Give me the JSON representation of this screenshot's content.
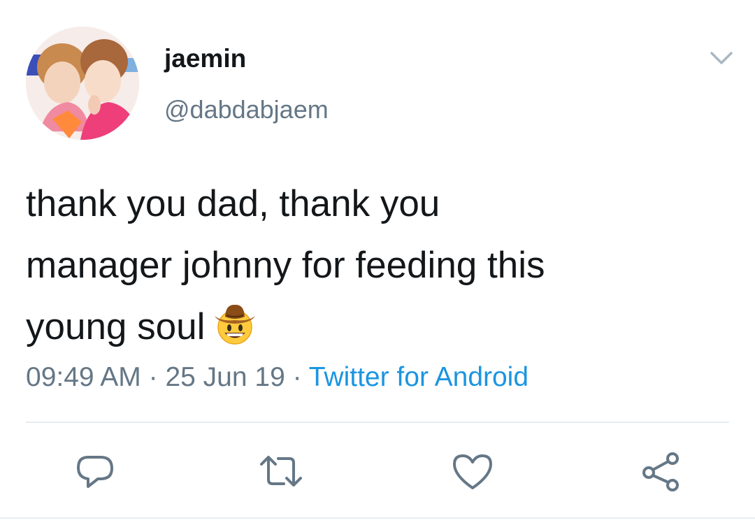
{
  "tweet": {
    "author": {
      "display_name": "jaemin",
      "handle": "@dabdabjaem"
    },
    "text": "thank you dad, thank you\nmanager johnny for feeding this\nyoung soul",
    "emoji": "cowboy-hat-face",
    "meta": {
      "time": "09:49 AM",
      "separator": " · ",
      "date": "25 Jun 19",
      "source": "Twitter for Android"
    }
  },
  "actions": [
    "reply-icon",
    "retweet-icon",
    "like-icon",
    "share-icon"
  ],
  "colors": {
    "text": "#14171a",
    "muted": "#657786",
    "accent": "#1b95e0",
    "divider": "#e6ecf0"
  }
}
